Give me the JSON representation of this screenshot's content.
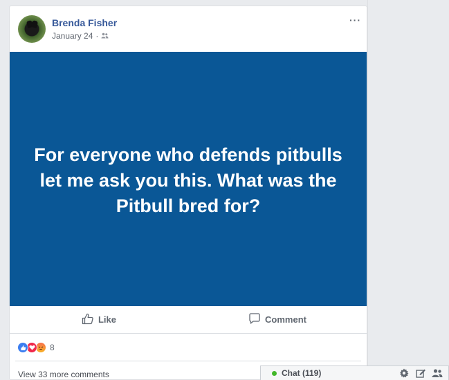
{
  "post": {
    "author": "Brenda Fisher",
    "date": "January 24",
    "separator": "·",
    "more_menu": "···",
    "privacy_icon": "friends-icon",
    "image_text": "For everyone who defends pitbulls let me ask you this. What was the Pitbull bred for?",
    "image_bg_color": "#0a5796"
  },
  "actions": {
    "like_label": "Like",
    "comment_label": "Comment"
  },
  "reactions": {
    "types": [
      "like",
      "love",
      "angry"
    ],
    "count": "8"
  },
  "comments": {
    "view_more": "View 33 more comments"
  },
  "chat": {
    "label": "Chat (119)",
    "status_color": "#42b72a",
    "icons": [
      "gear-icon",
      "compose-icon",
      "people-icon"
    ]
  }
}
